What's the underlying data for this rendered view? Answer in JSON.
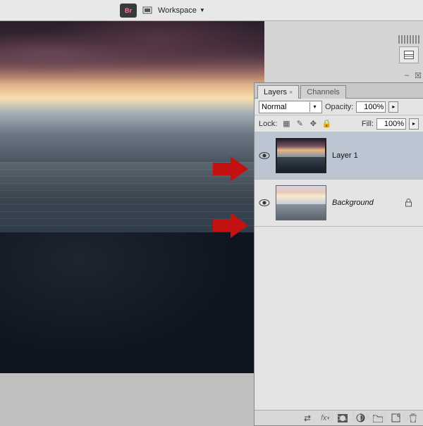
{
  "toolbar": {
    "bridge_label": "Br",
    "workspace_label": "Workspace"
  },
  "panel": {
    "tabs": {
      "layers": "Layers",
      "channels": "Channels"
    },
    "blend_mode": "Normal",
    "opacity_label": "Opacity:",
    "opacity_value": "100%",
    "lock_label": "Lock:",
    "fill_label": "Fill:",
    "fill_value": "100%"
  },
  "layers": [
    {
      "name": "Layer 1",
      "locked": false,
      "selected": true,
      "thumb": "dark"
    },
    {
      "name": "Background",
      "locked": true,
      "selected": false,
      "thumb": "light"
    }
  ],
  "footer_icons": [
    "link",
    "fx",
    "mask",
    "adjust",
    "group",
    "new",
    "trash"
  ],
  "watermark": "BBS.16XX8.COM"
}
